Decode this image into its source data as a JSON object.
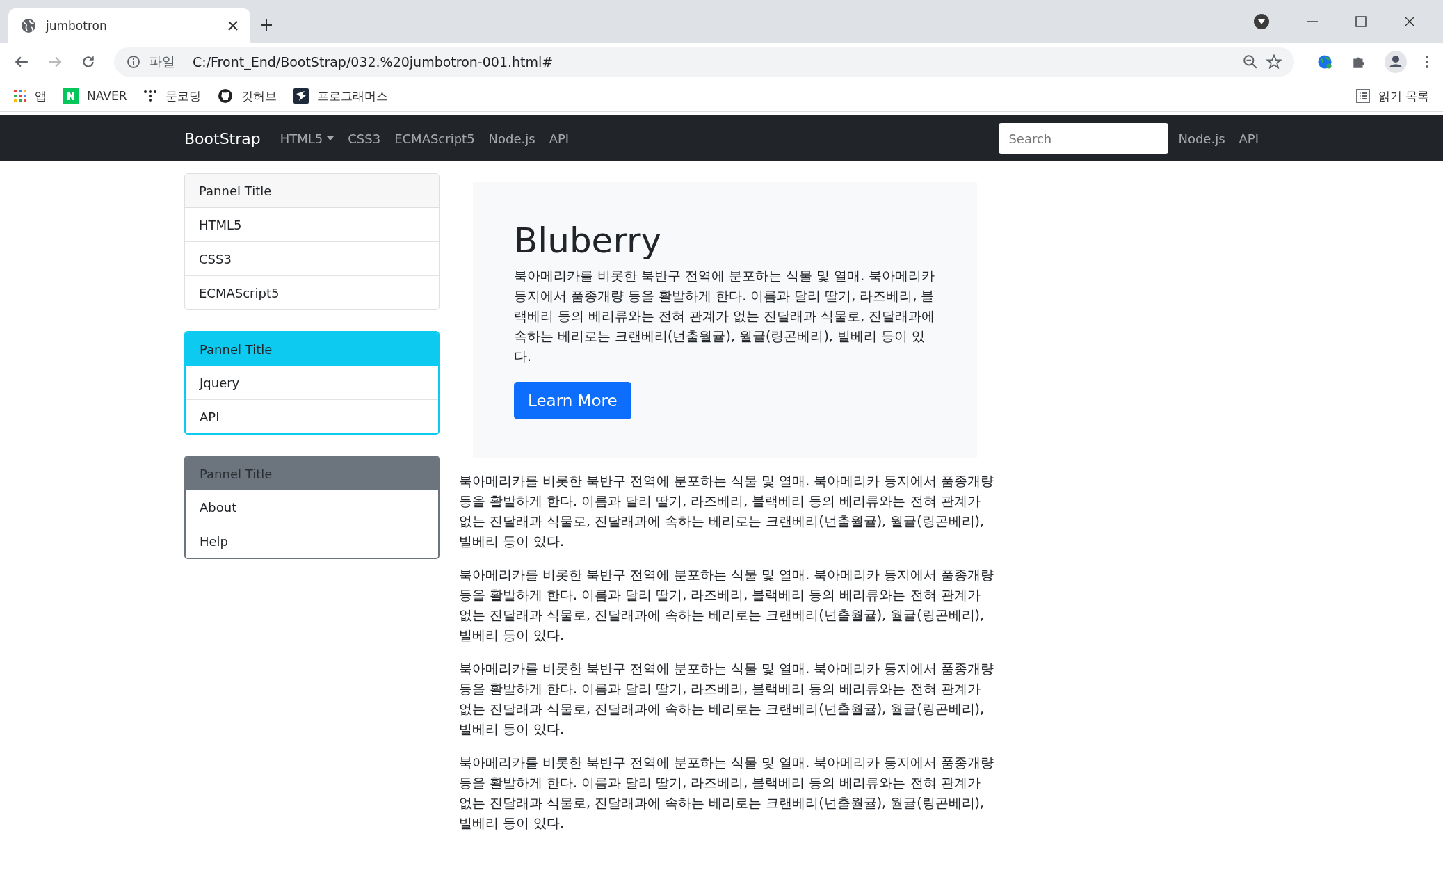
{
  "browser": {
    "tab_title": "jumbotron",
    "address_scheme": "파일",
    "url": "C:/Front_End/BootStrap/032.%20jumbotron-001.html#",
    "bookmarks": [
      {
        "kind": "apps",
        "label": "앱"
      },
      {
        "kind": "naver",
        "label": "NAVER"
      },
      {
        "kind": "dots",
        "label": "문코딩"
      },
      {
        "kind": "github",
        "label": "깃허브"
      },
      {
        "kind": "bird",
        "label": "프로그래머스"
      }
    ],
    "reading_list": "읽기 목록"
  },
  "navbar": {
    "brand": "BootStrap",
    "links": [
      {
        "label": "HTML5",
        "dropdown": true
      },
      {
        "label": "CSS3",
        "dropdown": false
      },
      {
        "label": "ECMAScript5",
        "dropdown": false
      },
      {
        "label": "Node.js",
        "dropdown": false
      },
      {
        "label": "API",
        "dropdown": false
      }
    ],
    "search": {
      "placeholder": "Search"
    },
    "right_links": [
      "Node.js",
      "API"
    ]
  },
  "sidebar": {
    "panels": [
      {
        "title": "Pannel Title",
        "kind": "default",
        "items": [
          "HTML5",
          "CSS3",
          "ECMAScript5"
        ]
      },
      {
        "title": "Pannel Title",
        "kind": "info",
        "items": [
          "Jquery",
          "API"
        ]
      },
      {
        "title": "Pannel Title",
        "kind": "secondary",
        "items": [
          "About",
          "Help"
        ]
      }
    ]
  },
  "jumbotron": {
    "heading": "Bluberry",
    "text": "북아메리카를 비롯한 북반구 전역에 분포하는 식물 및 열매. 북아메리카 등지에서 품종개량 등을 활발하게 한다. 이름과 달리 딸기, 라즈베리, 블랙베리 등의 베리류와는 전혀 관계가 없는 진달래과 식물로, 진달래과에 속하는 베리로는 크랜베리(넌출월귤), 월귤(링곤베리), 빌베리 등이 있다.",
    "button": "Learn More"
  },
  "paragraphs": [
    "북아메리카를 비롯한 북반구 전역에 분포하는 식물 및 열매. 북아메리카 등지에서 품종개량 등을 활발하게 한다. 이름과 달리 딸기, 라즈베리, 블랙베리 등의 베리류와는 전혀 관계가 없는 진달래과 식물로, 진달래과에 속하는 베리로는 크랜베리(넌출월귤), 월귤(링곤베리), 빌베리 등이 있다.",
    "북아메리카를 비롯한 북반구 전역에 분포하는 식물 및 열매. 북아메리카 등지에서 품종개량 등을 활발하게 한다. 이름과 달리 딸기, 라즈베리, 블랙베리 등의 베리류와는 전혀 관계가 없는 진달래과 식물로, 진달래과에 속하는 베리로는 크랜베리(넌출월귤), 월귤(링곤베리), 빌베리 등이 있다.",
    "북아메리카를 비롯한 북반구 전역에 분포하는 식물 및 열매. 북아메리카 등지에서 품종개량 등을 활발하게 한다. 이름과 달리 딸기, 라즈베리, 블랙베리 등의 베리류와는 전혀 관계가 없는 진달래과 식물로, 진달래과에 속하는 베리로는 크랜베리(넌출월귤), 월귤(링곤베리), 빌베리 등이 있다.",
    "북아메리카를 비롯한 북반구 전역에 분포하는 식물 및 열매. 북아메리카 등지에서 품종개량 등을 활발하게 한다. 이름과 달리 딸기, 라즈베리, 블랙베리 등의 베리류와는 전혀 관계가 없는 진달래과 식물로, 진달래과에 속하는 베리로는 크랜베리(넌출월귤), 월귤(링곤베리), 빌베리 등이 있다."
  ]
}
